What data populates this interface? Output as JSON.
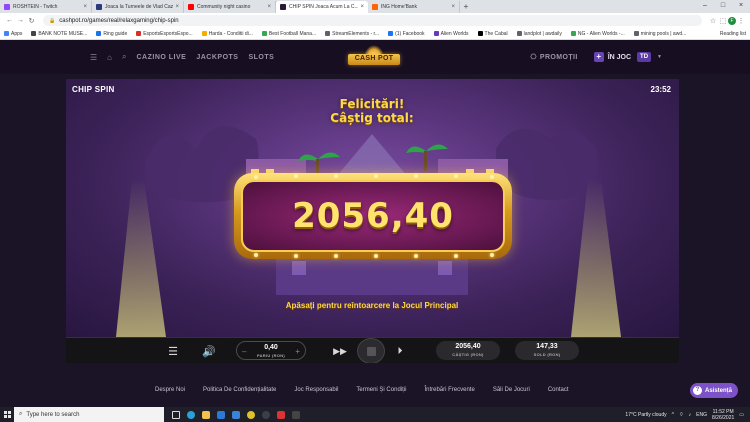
{
  "browser": {
    "tabs": [
      {
        "title": "ROSHTEIN - Twitch",
        "color": "#9146ff",
        "active": false
      },
      {
        "title": "Joaca la Turneele de Vlad Cazino",
        "color": "#2a3a7a",
        "active": false
      },
      {
        "title": "Community night casino",
        "color": "#ff0000",
        "active": false
      },
      {
        "title": "CHIP SPIN Joaca Acum La C...",
        "color": "#2b1a3a",
        "active": true
      },
      {
        "title": "ING Home'Bank",
        "color": "#ff6200",
        "active": false
      }
    ],
    "url": "cashpot.ro/games/real/relaxgaming/chip-spin",
    "bookmarks": [
      {
        "label": "Apps",
        "color": "#4285f4"
      },
      {
        "label": "BANK NOTE MUSE...",
        "color": "#444444"
      },
      {
        "label": "Ring guide",
        "color": "#1a73e8"
      },
      {
        "label": "EsportsEsportsEspo...",
        "color": "#d93025"
      },
      {
        "label": "Harda - Conditii di...",
        "color": "#f9ab00"
      },
      {
        "label": "Best Football Mana...",
        "color": "#34a853"
      },
      {
        "label": "StreamElements - r...",
        "color": "#5f6368"
      },
      {
        "label": "(1) Facebook",
        "color": "#1877f2"
      },
      {
        "label": "Alien Worlds",
        "color": "#673ab7"
      },
      {
        "label": "The Cabal",
        "color": "#000000"
      },
      {
        "label": "landplot | awdaily",
        "color": "#5f6368"
      },
      {
        "label": "NG - Alien Worlds -...",
        "color": "#34a853"
      },
      {
        "label": "mining pools | awd...",
        "color": "#5f6368"
      }
    ],
    "reading_list": "Reading list"
  },
  "site": {
    "nav": [
      "CAZINO LIVE",
      "JACKPOTS",
      "SLOTS"
    ],
    "logo_text": "CASH POT",
    "promo_label": "PROMOȚII",
    "join_label": "ÎN JOC",
    "lang_label": "TD"
  },
  "game": {
    "title": "CHIP SPIN",
    "clock": "23:52",
    "congrats_line1": "Felicitări!",
    "congrats_line2": "Câștig total:",
    "win_amount": "2056,40",
    "return_text": "Apăsați pentru reîntoarcere la Jocul Principal",
    "bet_value": "0,40",
    "bet_label": "PARIU (RON)",
    "win_value": "2056,40",
    "win_label": "CÂȘTIG (RON)",
    "balance_value": "147,33",
    "balance_label": "SOLD (RON)"
  },
  "footer": {
    "links": [
      "Despre Noi",
      "Politica De Confidențialitate",
      "Joc Responsabil",
      "Termeni Și Condiții",
      "Întrebări Frecvente",
      "Săli De Jocuri",
      "Contact"
    ],
    "assist_label": "Asistență"
  },
  "taskbar": {
    "search_placeholder": "Type here to search",
    "weather": "17°C  Partly cloudy",
    "lang": "ENG",
    "time": "11:52 PM",
    "date": "8/26/2021"
  }
}
